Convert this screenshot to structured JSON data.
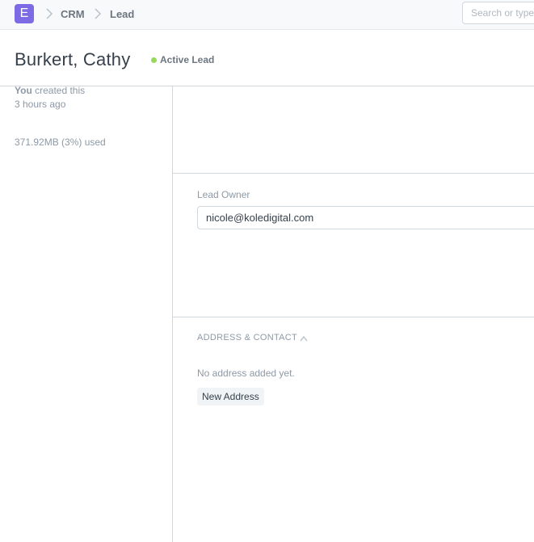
{
  "navbar": {
    "logo_letter": "E",
    "breadcrumbs": [
      "CRM",
      "Lead"
    ],
    "search_placeholder": "Search or type"
  },
  "page": {
    "title": "Burkert, Cathy",
    "status": "Active Lead",
    "status_color": "#98d85b"
  },
  "sidebar": {
    "created_by": "You",
    "created_text": " created this",
    "created_time": "3 hours ago",
    "storage": "371.92MB (3%) used"
  },
  "form": {
    "lead_owner_label": "Lead Owner",
    "lead_owner_value": "nicole@koledigital.com"
  },
  "address_section": {
    "heading": "ADDRESS & CONTACT",
    "empty_text": "No address added yet.",
    "new_button": "New Address"
  },
  "colors": {
    "brand": "#7b6ce6",
    "border": "#d1d8dd",
    "muted_text": "#8d99a6"
  }
}
